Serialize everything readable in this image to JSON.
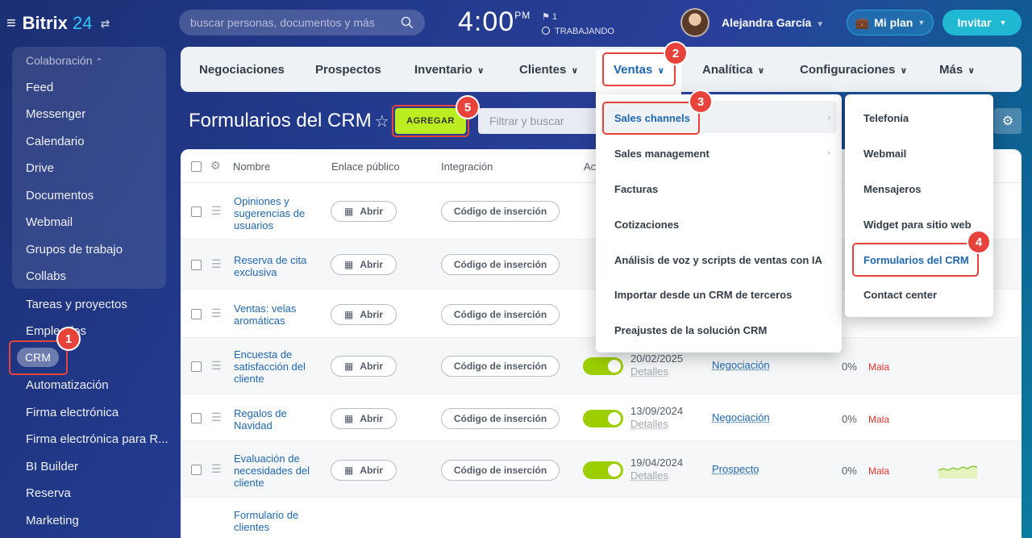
{
  "app": {
    "logo_text": "Bitrix",
    "logo_num": "24"
  },
  "header": {
    "search_placeholder": "buscar personas, documentos y más",
    "clock": "4:00",
    "clock_suffix": "PM",
    "flag_count": "1",
    "work_status": "TRABAJANDO",
    "user_name": "Alejandra García",
    "plan_label": "Mi plan",
    "invite_label": "Invitar"
  },
  "sidebar": {
    "group_label": "Colaboración",
    "items": [
      "Feed",
      "Messenger",
      "Calendario",
      "Drive",
      "Documentos",
      "Webmail",
      "Grupos de trabajo",
      "Collabs",
      "Tareas y proyectos",
      "Empleados",
      "CRM",
      "Automatización",
      "Firma electrónica",
      "Firma electrónica para R...",
      "BI Builder",
      "Reserva",
      "Marketing"
    ]
  },
  "crm_menu": {
    "items": [
      "Negociaciones",
      "Prospectos",
      "Inventario",
      "Clientes",
      "Ventas",
      "Analítica",
      "Configuraciones",
      "Más"
    ]
  },
  "page": {
    "title": "Formularios del CRM",
    "add_label": "AGREGAR",
    "filter_placeholder": "Filtrar y buscar"
  },
  "grid": {
    "columns": [
      "Nombre",
      "Enlace público",
      "Integración",
      "Ac"
    ],
    "open_label": "Abrir",
    "code_label": "Código de inserción",
    "details_label": "Detalles",
    "rows": [
      {
        "name": "Opiniones y sugerencias de usuarios"
      },
      {
        "name": "Reserva de cita exclusiva"
      },
      {
        "name": "Ventas: velas aromáticas"
      },
      {
        "name": "Encuesta de satisfacción del cliente",
        "date": "20/02/2025",
        "stage": "Negociación",
        "pct": "0%",
        "quality": "Mala"
      },
      {
        "name": "Regalos de Navidad",
        "date": "13/09/2024",
        "stage": "Negociación",
        "pct": "0%",
        "quality": "Mala"
      },
      {
        "name": "Evaluación de necesidades del cliente",
        "date": "19/04/2024",
        "stage": "Prospecto",
        "pct": "0%",
        "quality": "Mala"
      },
      {
        "name": "Formulario de clientes"
      }
    ]
  },
  "ventas_menu": {
    "items": [
      "Sales channels",
      "Sales management",
      "Facturas",
      "Cotizaciones",
      "Análisis de voz y scripts de ventas con IA",
      "Importar desde un CRM de terceros",
      "Preajustes de la solución CRM"
    ]
  },
  "channels_menu": {
    "items": [
      "Telefonía",
      "Webmail",
      "Mensajeros",
      "Widget para sitio web",
      "Formularios del CRM",
      "Contact center"
    ]
  },
  "callouts": [
    "1",
    "2",
    "3",
    "4",
    "5"
  ],
  "colors": {
    "accent_green": "#bbed21",
    "callout_red": "#e8433a",
    "link_blue": "#2067b0"
  }
}
